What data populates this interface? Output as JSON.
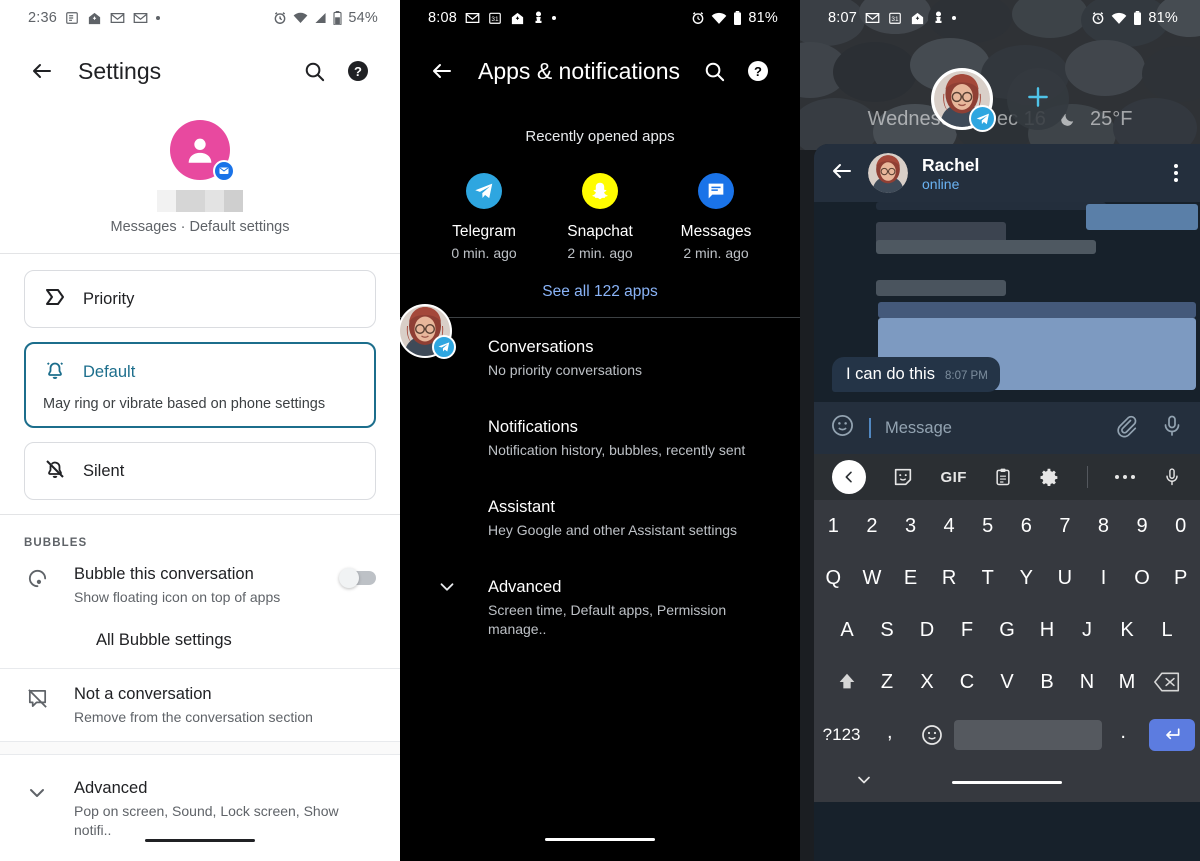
{
  "panel1": {
    "statusbar": {
      "time": "2:36",
      "battery": "54%",
      "icons_left": [
        "feed-icon",
        "home-assistant-icon",
        "gmail-icon",
        "gmail-icon",
        "more-dot-icon"
      ],
      "icons_right": [
        "alarm-icon",
        "wifi-icon",
        "signal-icon",
        "battery-icon"
      ]
    },
    "appbar": {
      "back": "back-icon",
      "title": "Settings",
      "search": "search-icon",
      "help": "help-icon"
    },
    "hero": {
      "app_badge": "messages-badge-icon",
      "name_redacted": true,
      "subtitle": "Messages · Default settings"
    },
    "importance_cards": [
      {
        "icon": "priority-icon",
        "label": "Priority",
        "desc": "",
        "selected": false
      },
      {
        "icon": "bell-ring-icon",
        "label": "Default",
        "desc": "May ring or vibrate based on phone settings",
        "selected": true
      },
      {
        "icon": "bell-off-icon",
        "label": "Silent",
        "desc": "",
        "selected": false
      }
    ],
    "bubbles_section": {
      "header": "BUBBLES",
      "row": {
        "icon": "bubble-icon",
        "title": "Bubble this conversation",
        "sub": "Show floating icon on top of apps",
        "toggle_on": false
      },
      "link": "All Bubble settings"
    },
    "not_conversation": {
      "icon": "no-conversation-icon",
      "title": "Not a conversation",
      "sub": "Remove from the conversation section"
    },
    "advanced": {
      "icon": "chevron-down-icon",
      "title": "Advanced",
      "sub": "Pop on screen, Sound, Lock screen, Show notifi.."
    },
    "accent": "#1C6E8C",
    "avatar_color": "#E8499F"
  },
  "panel2": {
    "statusbar": {
      "time": "8:08",
      "battery": "81%",
      "icons_left": [
        "gmail-icon",
        "calendar-icon",
        "home-assistant-icon",
        "chess-icon",
        "more-dot-icon"
      ],
      "icons_right": [
        "alarm-icon",
        "wifi-icon",
        "battery-icon"
      ]
    },
    "appbar": {
      "back": "back-icon",
      "title": "Apps & notifications",
      "search": "search-icon",
      "help": "help-icon"
    },
    "recent_head": "Recently opened apps",
    "recent_apps": [
      {
        "name": "Telegram",
        "time": "0 min. ago",
        "icon": "telegram-icon",
        "color": "#2EA6E0"
      },
      {
        "name": "Snapchat",
        "time": "2 min. ago",
        "icon": "snapchat-icon",
        "color": "#FFFC00"
      },
      {
        "name": "Messages",
        "time": "2 min. ago",
        "icon": "messages-icon",
        "color": "#1A73E8"
      }
    ],
    "see_all": "See all 122 apps",
    "list": [
      {
        "title": "Conversations",
        "sub": "No priority conversations",
        "chevron": false
      },
      {
        "title": "Notifications",
        "sub": "Notification history, bubbles, recently sent",
        "chevron": false
      },
      {
        "title": "Assistant",
        "sub": "Hey Google and other Assistant settings",
        "chevron": false
      },
      {
        "title": "Advanced",
        "sub": "Screen time, Default apps, Permission manage..",
        "chevron": true
      }
    ],
    "floating_bubble": {
      "badge": "telegram-icon",
      "avatar": "rachel-avatar"
    },
    "link_color": "#8AB4F8"
  },
  "panel3": {
    "statusbar": {
      "time": "8:07",
      "battery": "81%",
      "icons_left": [
        "gmail-icon",
        "calendar-icon",
        "home-assistant-icon",
        "chess-icon",
        "more-dot-icon"
      ],
      "icons_right": [
        "alarm-icon",
        "wifi-icon",
        "battery-icon"
      ]
    },
    "home": {
      "date_text": "Wednesday, Dec 16",
      "weather_icon": "moon-icon",
      "temperature": "25°F"
    },
    "bubbles": {
      "active_badge": "telegram-icon",
      "add_label": "+",
      "add_icon": "plus-icon"
    },
    "chat": {
      "back": "back-icon",
      "name": "Rachel",
      "status": "online",
      "menu": "overflow-menu-icon",
      "last_message": {
        "text": "I can do this",
        "time": "8:07 PM"
      },
      "input_placeholder": "Message",
      "emoji_icon": "emoji-icon",
      "attach_icon": "paperclip-icon",
      "mic_icon": "microphone-icon"
    },
    "keyboard": {
      "toolbar": [
        "back-chevron-icon",
        "sticker-icon",
        "GIF",
        "clipboard-icon",
        "gear-icon",
        "more-icon",
        "microphone-icon"
      ],
      "gif_label": "GIF",
      "row1": [
        "1",
        "2",
        "3",
        "4",
        "5",
        "6",
        "7",
        "8",
        "9",
        "0"
      ],
      "row2": [
        "Q",
        "W",
        "E",
        "R",
        "T",
        "Y",
        "U",
        "I",
        "O",
        "P"
      ],
      "row3": [
        "A",
        "S",
        "D",
        "F",
        "G",
        "H",
        "J",
        "K",
        "L"
      ],
      "row4": [
        "Z",
        "X",
        "C",
        "V",
        "B",
        "N",
        "M"
      ],
      "shift": "shift-icon",
      "backspace": "backspace-icon",
      "symbols": "?123",
      "comma": ",",
      "emoji": "emoji-icon",
      "space": "",
      "period": ".",
      "enter": "enter-icon",
      "hide": "chevron-down-icon",
      "enter_color": "#5C7CE0"
    }
  }
}
